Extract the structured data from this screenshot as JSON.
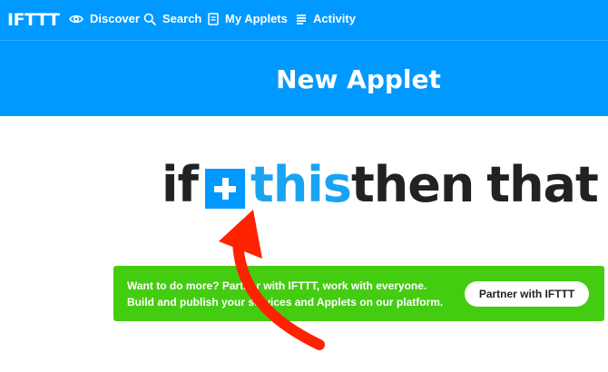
{
  "nav": {
    "logo": "IFTTT",
    "items": [
      {
        "label": "Discover",
        "icon": "eye-icon"
      },
      {
        "label": "Search",
        "icon": "search-icon"
      },
      {
        "label": "My Applets",
        "icon": "applets-icon"
      },
      {
        "label": "Activity",
        "icon": "activity-icon"
      }
    ]
  },
  "page": {
    "title": "New Applet"
  },
  "headline": {
    "if": "if",
    "this": "this",
    "then": "then",
    "that": "that"
  },
  "banner": {
    "text": "Want to do more? Partner with IFTTT, work with everyone. Build and publish your services and Applets on our platform.",
    "button_label": "Partner with IFTTT"
  },
  "colors": {
    "header_blue": "#0099ff",
    "this_blue": "#1aa3f0",
    "banner_green": "#44cc11",
    "arrow_red": "#ff2200"
  }
}
